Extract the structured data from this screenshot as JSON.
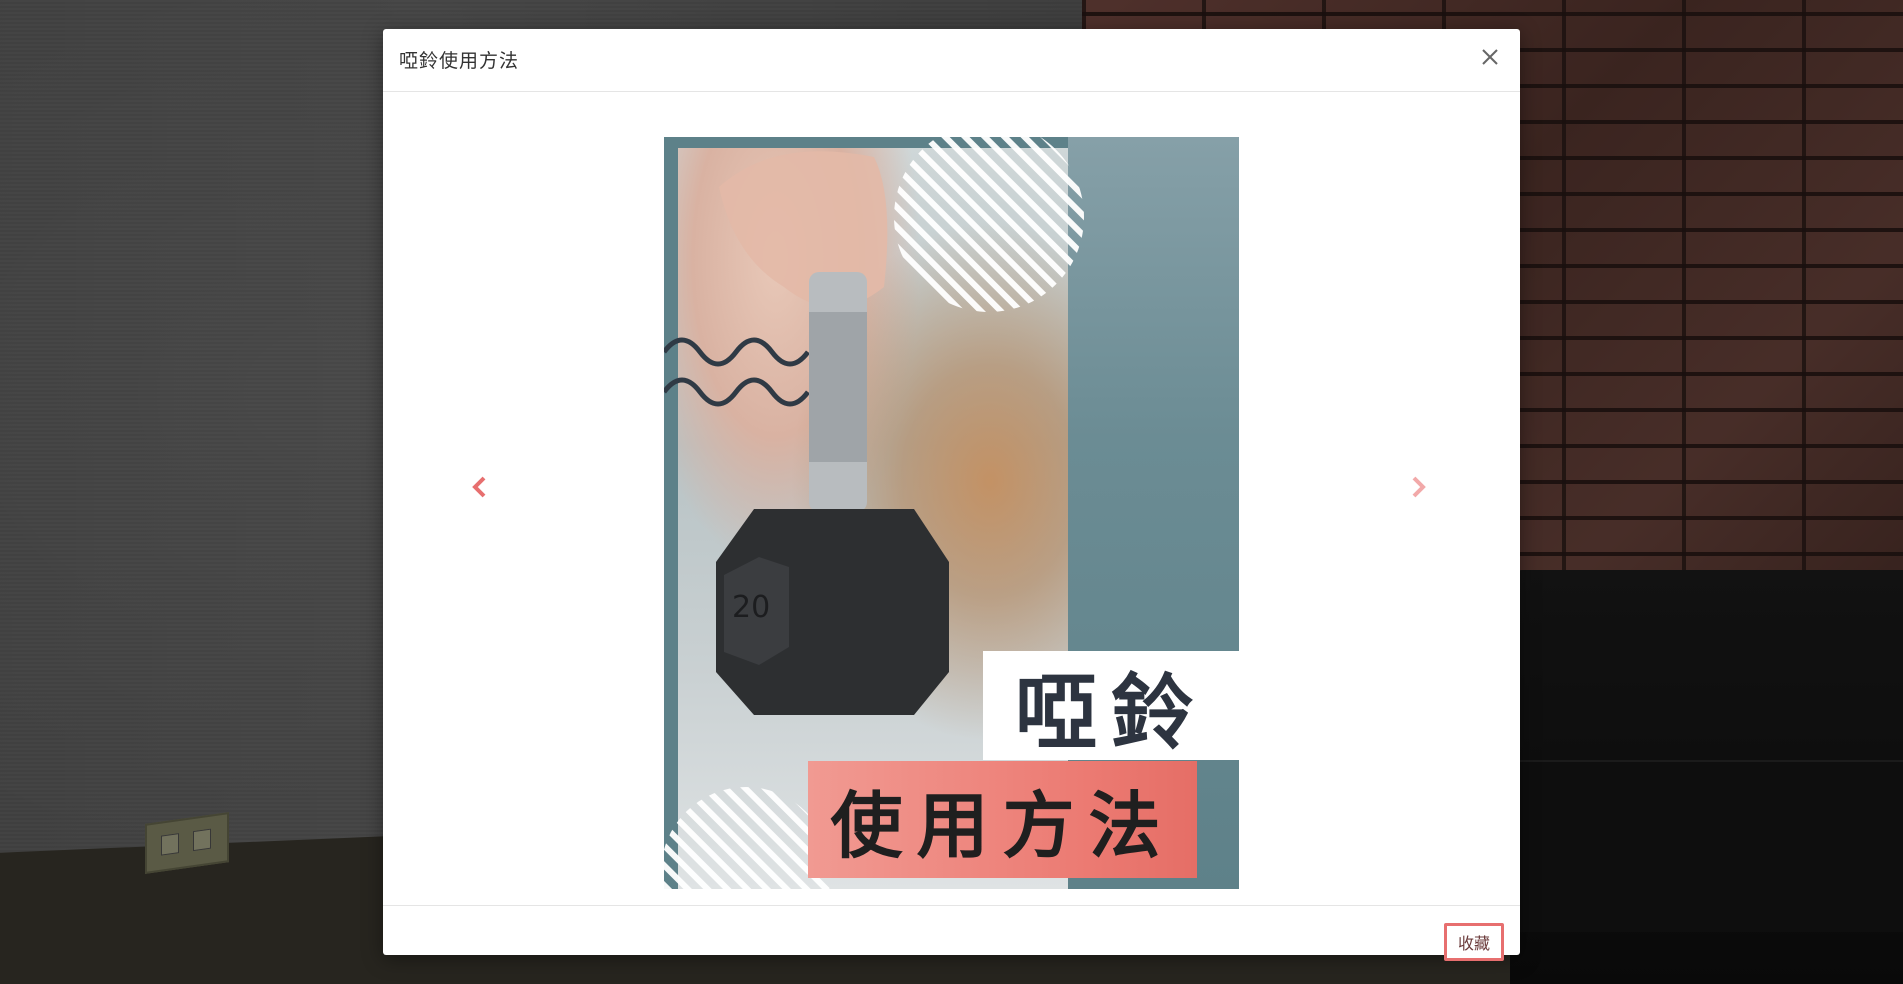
{
  "modal": {
    "title": "啞鈴使用方法",
    "close_icon": "close-icon",
    "footer": {
      "favorite_label": "收藏"
    }
  },
  "carousel": {
    "prev_icon": "chevron-left-icon",
    "next_icon": "chevron-right-icon",
    "slide": {
      "headline_line1": "啞鈴",
      "headline_line2": "使用方法",
      "dumbbell_weight_label": "20"
    }
  },
  "colors": {
    "accent": "#e76f6f",
    "poster_teal": "#5d8189",
    "poster_coral": "#ec7b73",
    "headline_dark": "#2d3440"
  }
}
